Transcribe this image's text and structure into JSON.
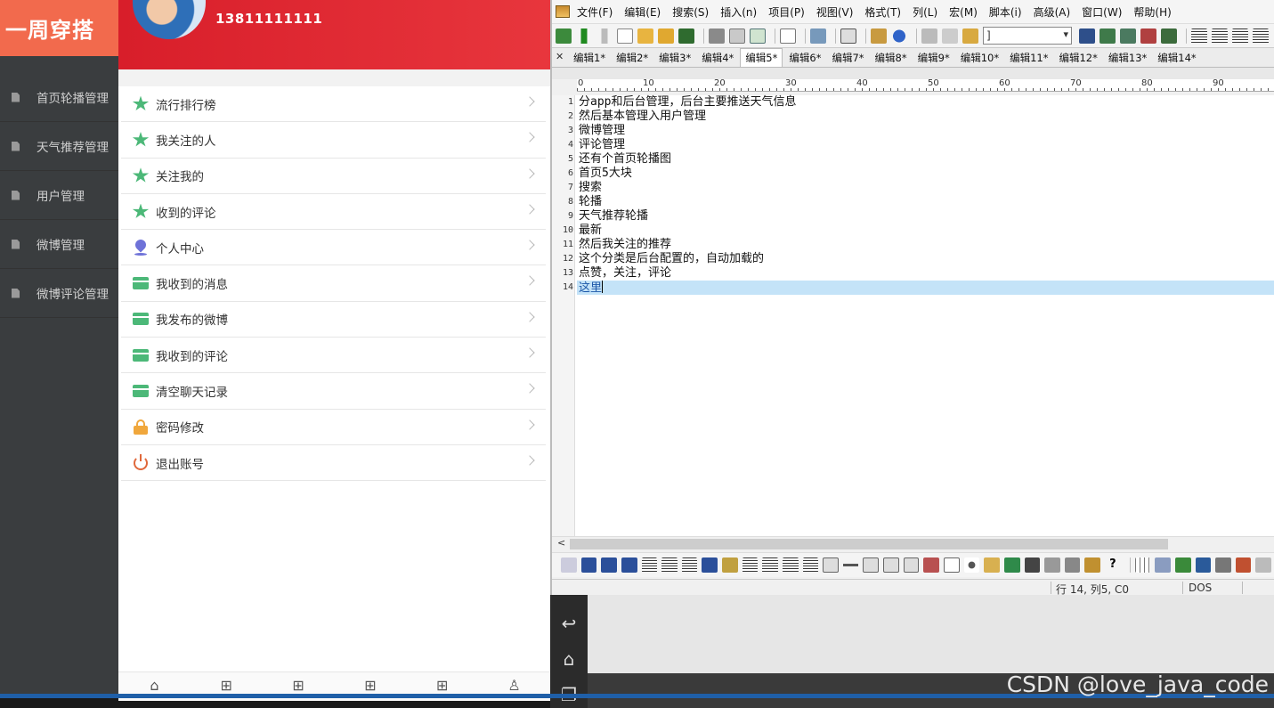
{
  "sidebar": {
    "brand": "一周穿搭",
    "items": [
      {
        "label": "首页轮播管理"
      },
      {
        "label": "天气推荐管理"
      },
      {
        "label": "用户管理"
      },
      {
        "label": "微博管理"
      },
      {
        "label": "微博评论管理"
      }
    ]
  },
  "phone": {
    "phone_number": "13811111111",
    "menu": [
      {
        "label": "流行排行榜",
        "icon": "star-icon"
      },
      {
        "label": "我关注的人",
        "icon": "star-icon"
      },
      {
        "label": "关注我的",
        "icon": "star-icon"
      },
      {
        "label": "收到的评论",
        "icon": "star-icon"
      },
      {
        "label": "个人中心",
        "icon": "location-pin-icon"
      },
      {
        "label": "我收到的消息",
        "icon": "card-icon"
      },
      {
        "label": "我发布的微博",
        "icon": "card-icon"
      },
      {
        "label": "我收到的评论",
        "icon": "card-icon"
      },
      {
        "label": "清空聊天记录",
        "icon": "card-icon"
      },
      {
        "label": "密码修改",
        "icon": "lock-icon"
      },
      {
        "label": "退出账号",
        "icon": "power-icon"
      }
    ],
    "tabbar_icons": [
      "home-icon",
      "grid-icon",
      "grid-icon",
      "grid-icon",
      "grid-icon",
      "user-icon"
    ]
  },
  "editor": {
    "menu": [
      "文件(F)",
      "编辑(E)",
      "搜索(S)",
      "插入(n)",
      "项目(P)",
      "视图(V)",
      "格式(T)",
      "列(L)",
      "宏(M)",
      "脚本(i)",
      "高级(A)",
      "窗口(W)",
      "帮助(H)"
    ],
    "combo_value": "]",
    "tabs": [
      "编辑1*",
      "编辑2*",
      "编辑3*",
      "编辑4*",
      "编辑5*",
      "编辑6*",
      "编辑7*",
      "编辑8*",
      "编辑9*",
      "编辑10*",
      "编辑11*",
      "编辑12*",
      "编辑13*",
      "编辑14*"
    ],
    "active_tab": "编辑5*",
    "ruler_labels": [
      "0",
      "10",
      "20",
      "30",
      "40",
      "50",
      "60",
      "70",
      "80",
      "90"
    ],
    "lines": [
      {
        "n": "1",
        "text": "分app和后台管理，后台主要推送天气信息"
      },
      {
        "n": "2",
        "text": "然后基本管理入用户管理"
      },
      {
        "n": "3",
        "text": "微博管理"
      },
      {
        "n": "4",
        "text": "评论管理"
      },
      {
        "n": "5",
        "text": "还有个首页轮播图"
      },
      {
        "n": "6",
        "text": "首页5大块"
      },
      {
        "n": "7",
        "text": "搜索"
      },
      {
        "n": "8",
        "text": "轮播"
      },
      {
        "n": "9",
        "text": "天气推荐轮播"
      },
      {
        "n": "10",
        "text": "最新"
      },
      {
        "n": "11",
        "text": "然后我关注的推荐"
      },
      {
        "n": "12",
        "text": "这个分类是后台配置的，自动加载的"
      },
      {
        "n": "13",
        "text": "点赞，关注，评论"
      },
      {
        "n": "14",
        "text": "这里"
      }
    ],
    "status_position": "行 14, 列5, C0",
    "status_format": "DOS"
  },
  "watermark": "CSDN @love_java_code",
  "colors": {
    "brand_orange": "#f26a4d",
    "header_red": "#e0282f",
    "icon_green": "#4cb878",
    "current_line": "#c4e3f8"
  }
}
